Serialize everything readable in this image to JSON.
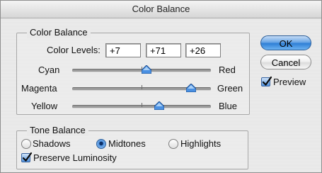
{
  "window": {
    "title": "Color Balance"
  },
  "color_balance": {
    "group_label": "Color Balance",
    "levels_label": "Color Levels:",
    "levels": [
      "+7",
      "+71",
      "+26"
    ],
    "sliders": [
      {
        "left": "Cyan",
        "right": "Red",
        "value": 7
      },
      {
        "left": "Magenta",
        "right": "Green",
        "value": 71
      },
      {
        "left": "Yellow",
        "right": "Blue",
        "value": 26
      }
    ],
    "slider_range": [
      -100,
      100
    ]
  },
  "buttons": {
    "ok": "OK",
    "cancel": "Cancel"
  },
  "preview": {
    "label": "Preview",
    "checked": true
  },
  "tone_balance": {
    "group_label": "Tone Balance",
    "options": [
      "Shadows",
      "Midtones",
      "Highlights"
    ],
    "selected": "Midtones",
    "preserve_label": "Preserve Luminosity",
    "preserve_checked": true
  },
  "colors": {
    "accent": "#3b82d6",
    "thumb": "#4a90e2"
  }
}
